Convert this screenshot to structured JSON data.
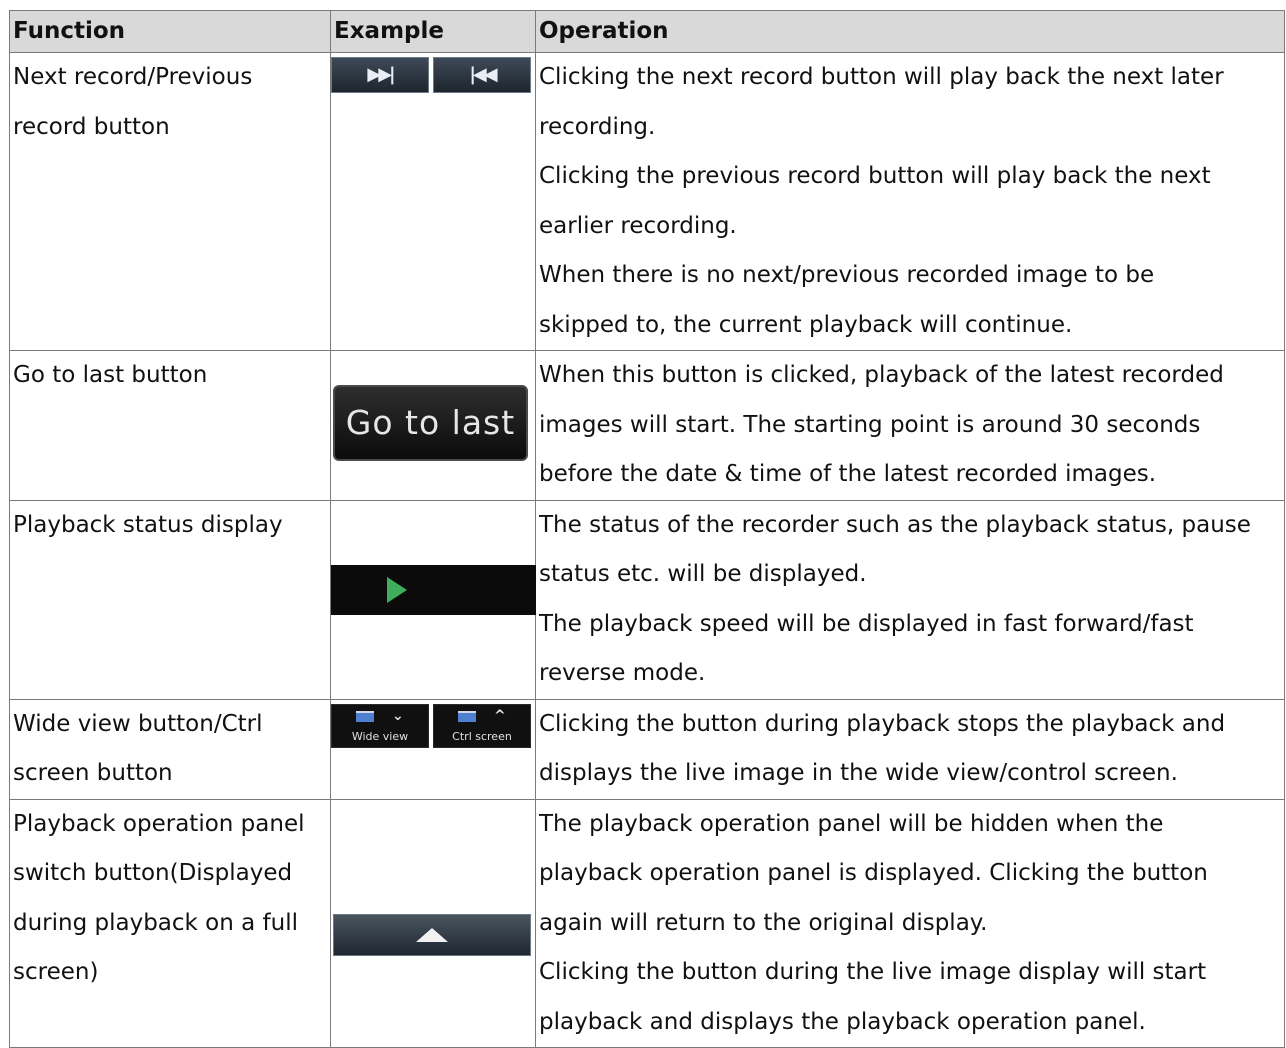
{
  "headers": {
    "function": "Function",
    "example": "Example",
    "operation": "Operation"
  },
  "rows": [
    {
      "function": [
        "Next record/Previous",
        "record button"
      ],
      "example": {
        "next_glyph": "▶▶|",
        "prev_glyph": "|◀◀"
      },
      "operation": [
        "Clicking the next record button will play back the next later",
        "recording.",
        "Clicking the previous record button will play back the next",
        "earlier recording.",
        "When there is no next/previous recorded image to be",
        "skipped to, the current playback will continue."
      ]
    },
    {
      "function": [
        "Go to last button"
      ],
      "example": {
        "label": "Go to last"
      },
      "operation": [
        "When this button is clicked, playback of the latest recorded",
        "images will start. The starting point is around 30 seconds",
        "before the date & time of the latest recorded images."
      ]
    },
    {
      "function": [
        "Playback status display"
      ],
      "example": {
        "status_icon": "play-icon",
        "status_color": "#3fae5c"
      },
      "operation": [
        "The status of the recorder such as the playback status, pause",
        "status etc. will be displayed.",
        "The playback speed will be displayed in fast forward/fast",
        "reverse mode."
      ]
    },
    {
      "function": [
        "Wide view button/Ctrl",
        "screen button"
      ],
      "example": {
        "wide_label": "Wide view",
        "ctrl_label": "Ctrl screen"
      },
      "operation": [
        "Clicking the button during playback stops the playback and",
        "displays the live image in the wide view/control screen."
      ]
    },
    {
      "function": [
        "Playback operation panel",
        "switch button(Displayed",
        "during playback on a full",
        "screen)"
      ],
      "example": {
        "icon": "chevron-up-icon"
      },
      "operation": [
        "The playback operation panel will be hidden when the",
        "playback operation panel is displayed. Clicking the button",
        "again will return to the original display.",
        "Clicking the button during the live image display will start",
        "playback and displays the playback operation panel."
      ]
    }
  ]
}
